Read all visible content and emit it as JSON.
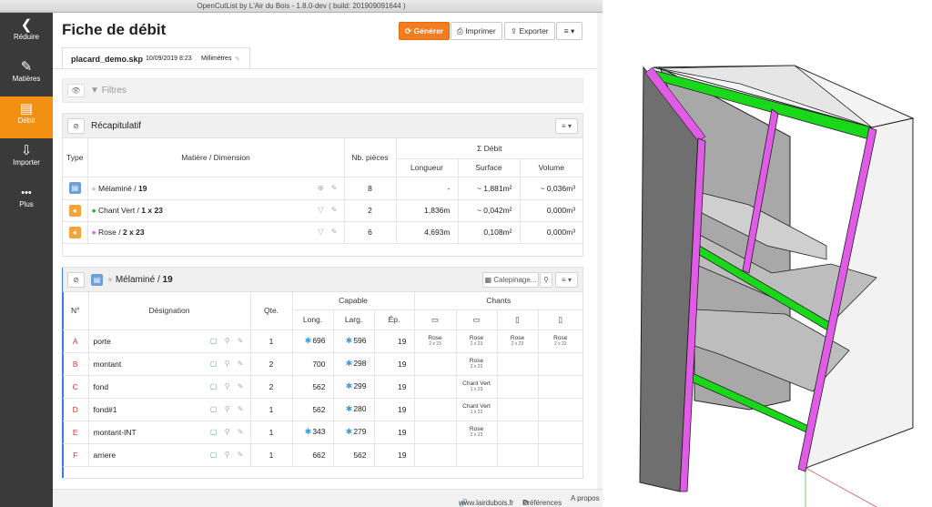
{
  "window_title": "OpenCutList by L'Air du Bois - 1.8.0-dev ( build: 201909091644 )",
  "sidebar": {
    "items": [
      {
        "label": "Réduire",
        "icon": "chevron-left-icon",
        "glyph": "❮"
      },
      {
        "label": "Matières",
        "icon": "material-icon",
        "glyph": "✎"
      },
      {
        "label": "Débit",
        "icon": "cutlist-icon",
        "glyph": "▤"
      },
      {
        "label": "Importer",
        "icon": "import-icon",
        "glyph": "⇩"
      },
      {
        "label": "Plus",
        "icon": "more-icon",
        "glyph": "•••"
      }
    ],
    "active_color": "#f39012"
  },
  "header": {
    "title": "Fiche de débit",
    "buttons": {
      "generate": "Générer",
      "print": "Imprimer",
      "export": "Exporter"
    },
    "generate_icon": "⟳",
    "print_icon": "⎙",
    "export_icon": "⇪",
    "menu_glyph": "≡ ▾"
  },
  "doc_tab": {
    "filename": "placard_demo.skp",
    "date": "10/09/2019 8:23",
    "units": "Millimètres",
    "edit_glyph": "✎"
  },
  "filters": {
    "label": "Filtres",
    "eye_glyph": "👁",
    "funnel_glyph": "▼"
  },
  "summary": {
    "title": "Récapitulatif",
    "hide_glyph": "⊘",
    "menu_glyph": "≡ ▾",
    "headers": {
      "type": "Type",
      "material": "Matière / Dimension",
      "count": "Nb. pièces",
      "sum": "Σ Débit",
      "length": "Longueur",
      "area": "Surface",
      "volume": "Volume"
    },
    "rows": [
      {
        "material": "Mélaminé",
        "dim": "19",
        "count": "8",
        "length": "-",
        "area": "~ 1,881m²",
        "volume": "~ 0,036m³",
        "dot": "grey",
        "type": "blue",
        "act": "⊕ ✎"
      },
      {
        "material": "Chant Vert",
        "dim": "1 x 23",
        "count": "2",
        "length": "1,836m",
        "area": "~ 0,042m²",
        "volume": "0,000m³",
        "dot": "green",
        "type": "orange",
        "act": "▽ ✎"
      },
      {
        "material": "Rose",
        "dim": "2 x 23",
        "count": "6",
        "length": "4,693m",
        "area": "0,108m²",
        "volume": "0,000m³",
        "dot": "pink",
        "type": "orange",
        "act": "▽ ✎"
      }
    ]
  },
  "group": {
    "material": "Mélaminé",
    "dim": "19",
    "calepinage_label": "Calepinage...",
    "calepinage_glyph": "▦",
    "menu_glyph": "≡ ▾",
    "headers": {
      "no": "N°",
      "designation": "Désignation",
      "qty": "Qte.",
      "capable": "Capable",
      "long": "Long.",
      "larg": "Larg.",
      "ep": "Ép.",
      "chants": "Chants"
    },
    "edge_icons": [
      "▭",
      "▭",
      "▯",
      "▯"
    ],
    "parts": [
      {
        "letter": "A",
        "name": "porte",
        "qty": "1",
        "long": "696",
        "larg": "596",
        "ep": "19",
        "chants": [
          [
            "Rose",
            "2 x 23"
          ],
          [
            "Rose",
            "2 x 23"
          ],
          [
            "Rose",
            "2 x 23"
          ],
          [
            "Rose",
            "2 x 23"
          ]
        ],
        "starL": true,
        "starW": true
      },
      {
        "letter": "B",
        "name": "montant",
        "qty": "2",
        "long": "700",
        "larg": "298",
        "ep": "19",
        "chants": [
          [
            "",
            ""
          ],
          [
            "Rose",
            "2 x 23"
          ],
          [
            "",
            ""
          ],
          [
            "",
            ""
          ]
        ],
        "starL": false,
        "starW": true
      },
      {
        "letter": "C",
        "name": "fond",
        "qty": "2",
        "long": "562",
        "larg": "299",
        "ep": "19",
        "chants": [
          [
            "",
            ""
          ],
          [
            "Chant Vert",
            "1 x 23"
          ],
          [
            "",
            ""
          ],
          [
            "",
            ""
          ]
        ],
        "starL": false,
        "starW": true
      },
      {
        "letter": "D",
        "name": "fond#1",
        "qty": "1",
        "long": "562",
        "larg": "280",
        "ep": "19",
        "chants": [
          [
            "",
            ""
          ],
          [
            "Chant Vert",
            "1 x 23"
          ],
          [
            "",
            ""
          ],
          [
            "",
            ""
          ]
        ],
        "starL": false,
        "starW": true
      },
      {
        "letter": "E",
        "name": "montant-INT",
        "qty": "1",
        "long": "343",
        "larg": "279",
        "ep": "19",
        "chants": [
          [
            "",
            ""
          ],
          [
            "Rose",
            "2 x 23"
          ],
          [
            "",
            ""
          ],
          [
            "",
            ""
          ]
        ],
        "starL": true,
        "starW": true
      },
      {
        "letter": "F",
        "name": "arriere",
        "qty": "1",
        "long": "662",
        "larg": "562",
        "ep": "19",
        "chants": [
          [
            "",
            ""
          ],
          [
            "",
            ""
          ],
          [
            "",
            ""
          ],
          [
            "",
            ""
          ]
        ],
        "starL": false,
        "starW": false
      }
    ]
  },
  "footer": {
    "website": "www.lairdubois.fr",
    "prefs": "Préférences",
    "about": "A propos",
    "link_glyph": "🔗",
    "gear_glyph": "⚙"
  },
  "colors": {
    "accent": "#f47b20",
    "edge_green": "#19d719",
    "edge_pink": "#e05ce6",
    "letter_red": "#d9332b"
  }
}
